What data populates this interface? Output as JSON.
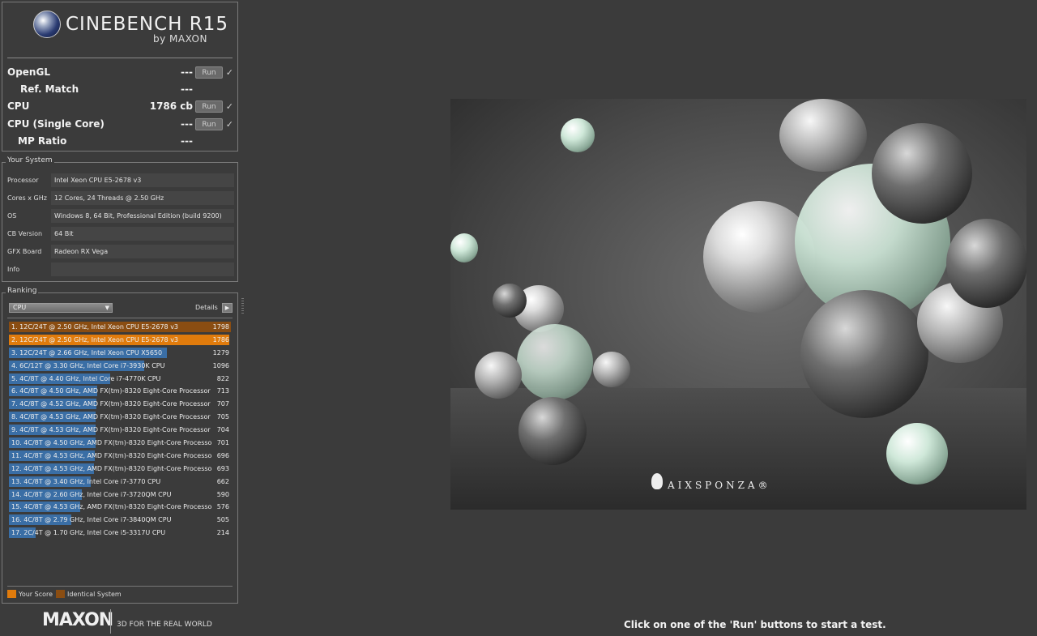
{
  "header": {
    "logo_text": "CINEBENCH R15",
    "logo_sub": "by MAXON"
  },
  "scores": [
    {
      "label": "OpenGL",
      "value": "---",
      "run_label": "Run",
      "check": "✓"
    },
    {
      "label": "Ref. Match",
      "value": "---"
    },
    {
      "label": "CPU",
      "value": "1786 cb",
      "run_label": "Run",
      "check": "✓"
    },
    {
      "label": "CPU (Single Core)",
      "value": "---",
      "run_label": "Run",
      "check": "✓"
    },
    {
      "label": "MP Ratio",
      "value": "---"
    }
  ],
  "system": {
    "title": "Your System",
    "rows": [
      {
        "label": "Processor",
        "value": "Intel Xeon CPU E5-2678 v3"
      },
      {
        "label": "Cores x GHz",
        "value": "12 Cores, 24 Threads @ 2.50 GHz"
      },
      {
        "label": "OS",
        "value": "Windows 8, 64 Bit, Professional Edition (build 9200)"
      },
      {
        "label": "CB Version",
        "value": "64 Bit"
      },
      {
        "label": "GFX Board",
        "value": "Radeon RX Vega"
      },
      {
        "label": "Info",
        "value": ""
      }
    ]
  },
  "ranking": {
    "title": "Ranking",
    "select_value": "CPU",
    "details_label": "Details",
    "items": [
      {
        "name": "1. 12C/24T @ 2.50 GHz, Intel Xeon CPU E5-2678 v3",
        "score": "1798",
        "fraction": 1.0,
        "kind": "identical"
      },
      {
        "name": "2. 12C/24T @ 2.50 GHz, Intel Xeon CPU E5-2678 v3",
        "score": "1786",
        "fraction": 0.993,
        "kind": "yours"
      },
      {
        "name": "3. 12C/24T @ 2.66 GHz, Intel Xeon CPU X5650",
        "score": "1279",
        "fraction": 0.711,
        "kind": "normal"
      },
      {
        "name": "4. 6C/12T @ 3.30 GHz,  Intel Core i7-3930K CPU",
        "score": "1096",
        "fraction": 0.61,
        "kind": "normal"
      },
      {
        "name": "5. 4C/8T @ 4.40 GHz, Intel Core i7-4770K CPU",
        "score": "822",
        "fraction": 0.457,
        "kind": "normal"
      },
      {
        "name": "6. 4C/8T @ 4.50 GHz, AMD FX(tm)-8320 Eight-Core Processor",
        "score": "713",
        "fraction": 0.397,
        "kind": "normal"
      },
      {
        "name": "7. 4C/8T @ 4.52 GHz, AMD FX(tm)-8320 Eight-Core Processor",
        "score": "707",
        "fraction": 0.393,
        "kind": "normal"
      },
      {
        "name": "8. 4C/8T @ 4.53 GHz, AMD FX(tm)-8320 Eight-Core Processor",
        "score": "705",
        "fraction": 0.392,
        "kind": "normal"
      },
      {
        "name": "9. 4C/8T @ 4.53 GHz, AMD FX(tm)-8320 Eight-Core Processor",
        "score": "704",
        "fraction": 0.392,
        "kind": "normal"
      },
      {
        "name": "10. 4C/8T @ 4.50 GHz, AMD FX(tm)-8320 Eight-Core Processo",
        "score": "701",
        "fraction": 0.39,
        "kind": "normal"
      },
      {
        "name": "11. 4C/8T @ 4.53 GHz, AMD FX(tm)-8320 Eight-Core Processo",
        "score": "696",
        "fraction": 0.387,
        "kind": "normal"
      },
      {
        "name": "12. 4C/8T @ 4.53 GHz, AMD FX(tm)-8320 Eight-Core Processo",
        "score": "693",
        "fraction": 0.385,
        "kind": "normal"
      },
      {
        "name": "13. 4C/8T @ 3.40 GHz,  Intel Core i7-3770 CPU",
        "score": "662",
        "fraction": 0.368,
        "kind": "normal"
      },
      {
        "name": "14. 4C/8T @ 2.60 GHz,  Intel Core i7-3720QM CPU",
        "score": "590",
        "fraction": 0.328,
        "kind": "normal"
      },
      {
        "name": "15. 4C/8T @ 4.53 GHz, AMD FX(tm)-8320 Eight-Core Processo",
        "score": "576",
        "fraction": 0.32,
        "kind": "normal"
      },
      {
        "name": "16. 4C/8T @ 2.79 GHz,  Intel Core i7-3840QM CPU",
        "score": "505",
        "fraction": 0.281,
        "kind": "normal"
      },
      {
        "name": "17. 2C/4T @ 1.70 GHz,  Intel Core i5-3317U CPU",
        "score": "214",
        "fraction": 0.119,
        "kind": "normal"
      }
    ],
    "legend": {
      "yours": "Your Score",
      "identical": "Identical System"
    }
  },
  "footer": {
    "brand": "MAXON",
    "tagline": "3D FOR THE REAL WORLD"
  },
  "render": {
    "brand": "AIXSPONZA®"
  },
  "status_text": "Click on one of the 'Run' buttons to start a test.",
  "colors": {
    "your_score": "#e07b0c",
    "identical_system": "#8a4d12",
    "rank_bar": "#3a6ea5"
  }
}
